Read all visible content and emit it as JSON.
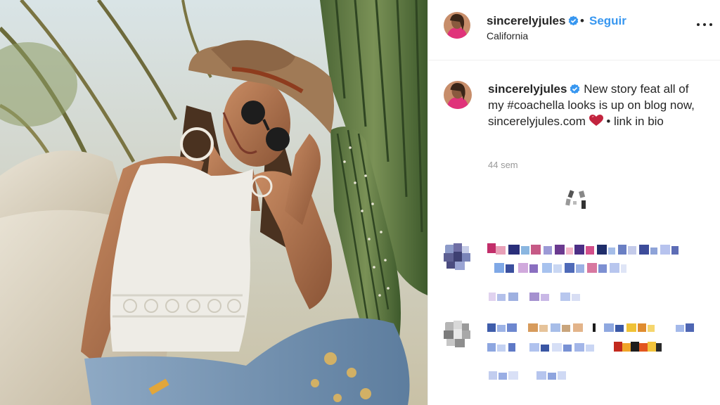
{
  "post": {
    "username": "sincerelyjules",
    "separator": "•",
    "follow_label": "Seguir",
    "location": "California",
    "more_icon": "more-horizontal-icon",
    "verified_icon": "verified-badge-icon"
  },
  "caption": {
    "username": "sincerelyjules",
    "text_before": "New story feat all of my ",
    "hashtag": "#coachella",
    "text_middle": " looks is up on blog now, sincerelyjules.com ",
    "text_after": " • link in bio",
    "heart_icon": "red-heart-icon",
    "time": "44 sem"
  },
  "loading": {
    "icon": "loading-spinner-icon"
  },
  "colors": {
    "follow_blue": "#3897f0",
    "verified_blue": "#3897f0",
    "heart_red": "#e0245e",
    "text": "#262626",
    "muted": "#999999"
  }
}
